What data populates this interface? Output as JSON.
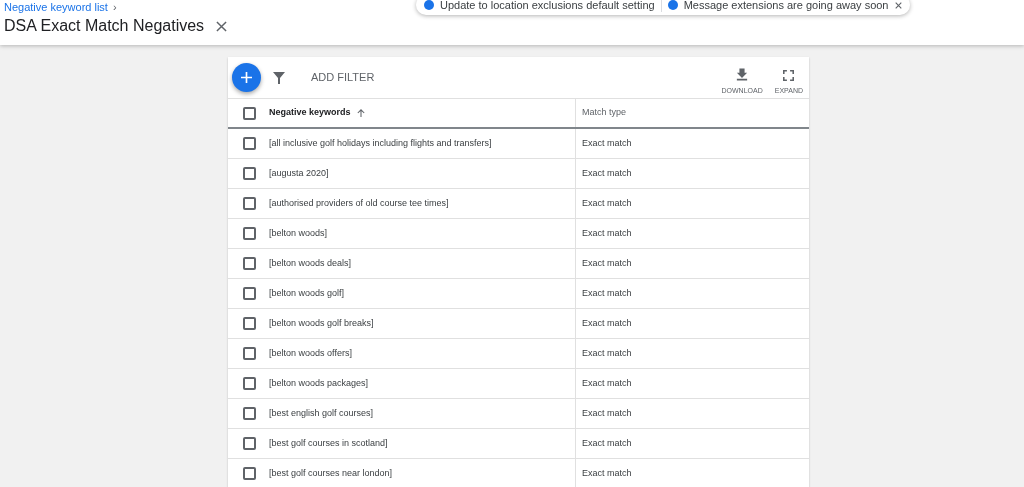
{
  "breadcrumb": {
    "link": "Negative keyword list",
    "separator": "›"
  },
  "page_title": "DSA Exact Match Negatives",
  "notifications": [
    {
      "text": "Update to location exclusions default setting"
    },
    {
      "text": "Message extensions are going away soon"
    }
  ],
  "toolbar": {
    "add_filter": "ADD FILTER",
    "actions": [
      {
        "kind": "download",
        "label": "DOWNLOAD"
      },
      {
        "kind": "expand",
        "label": "EXPAND"
      }
    ]
  },
  "table": {
    "select_all_checked": false,
    "columns": [
      {
        "label": "Negative keywords",
        "sorted": true
      },
      {
        "label": "Match type",
        "sorted": false
      }
    ],
    "rows": [
      {
        "keyword": "[all inclusive golf holidays including flights and transfers]",
        "match_type": "Exact match",
        "checked": false
      },
      {
        "keyword": "[augusta 2020]",
        "match_type": "Exact match",
        "checked": false
      },
      {
        "keyword": "[authorised providers of old course tee times]",
        "match_type": "Exact match",
        "checked": false
      },
      {
        "keyword": "[belton woods]",
        "match_type": "Exact match",
        "checked": false
      },
      {
        "keyword": "[belton woods deals]",
        "match_type": "Exact match",
        "checked": false
      },
      {
        "keyword": "[belton woods golf]",
        "match_type": "Exact match",
        "checked": false
      },
      {
        "keyword": "[belton woods golf breaks]",
        "match_type": "Exact match",
        "checked": false
      },
      {
        "keyword": "[belton woods offers]",
        "match_type": "Exact match",
        "checked": false
      },
      {
        "keyword": "[belton woods packages]",
        "match_type": "Exact match",
        "checked": false
      },
      {
        "keyword": "[best english golf courses]",
        "match_type": "Exact match",
        "checked": false
      },
      {
        "keyword": "[best golf courses in scotland]",
        "match_type": "Exact match",
        "checked": false
      },
      {
        "keyword": "[best golf courses near london]",
        "match_type": "Exact match",
        "checked": false
      }
    ]
  }
}
